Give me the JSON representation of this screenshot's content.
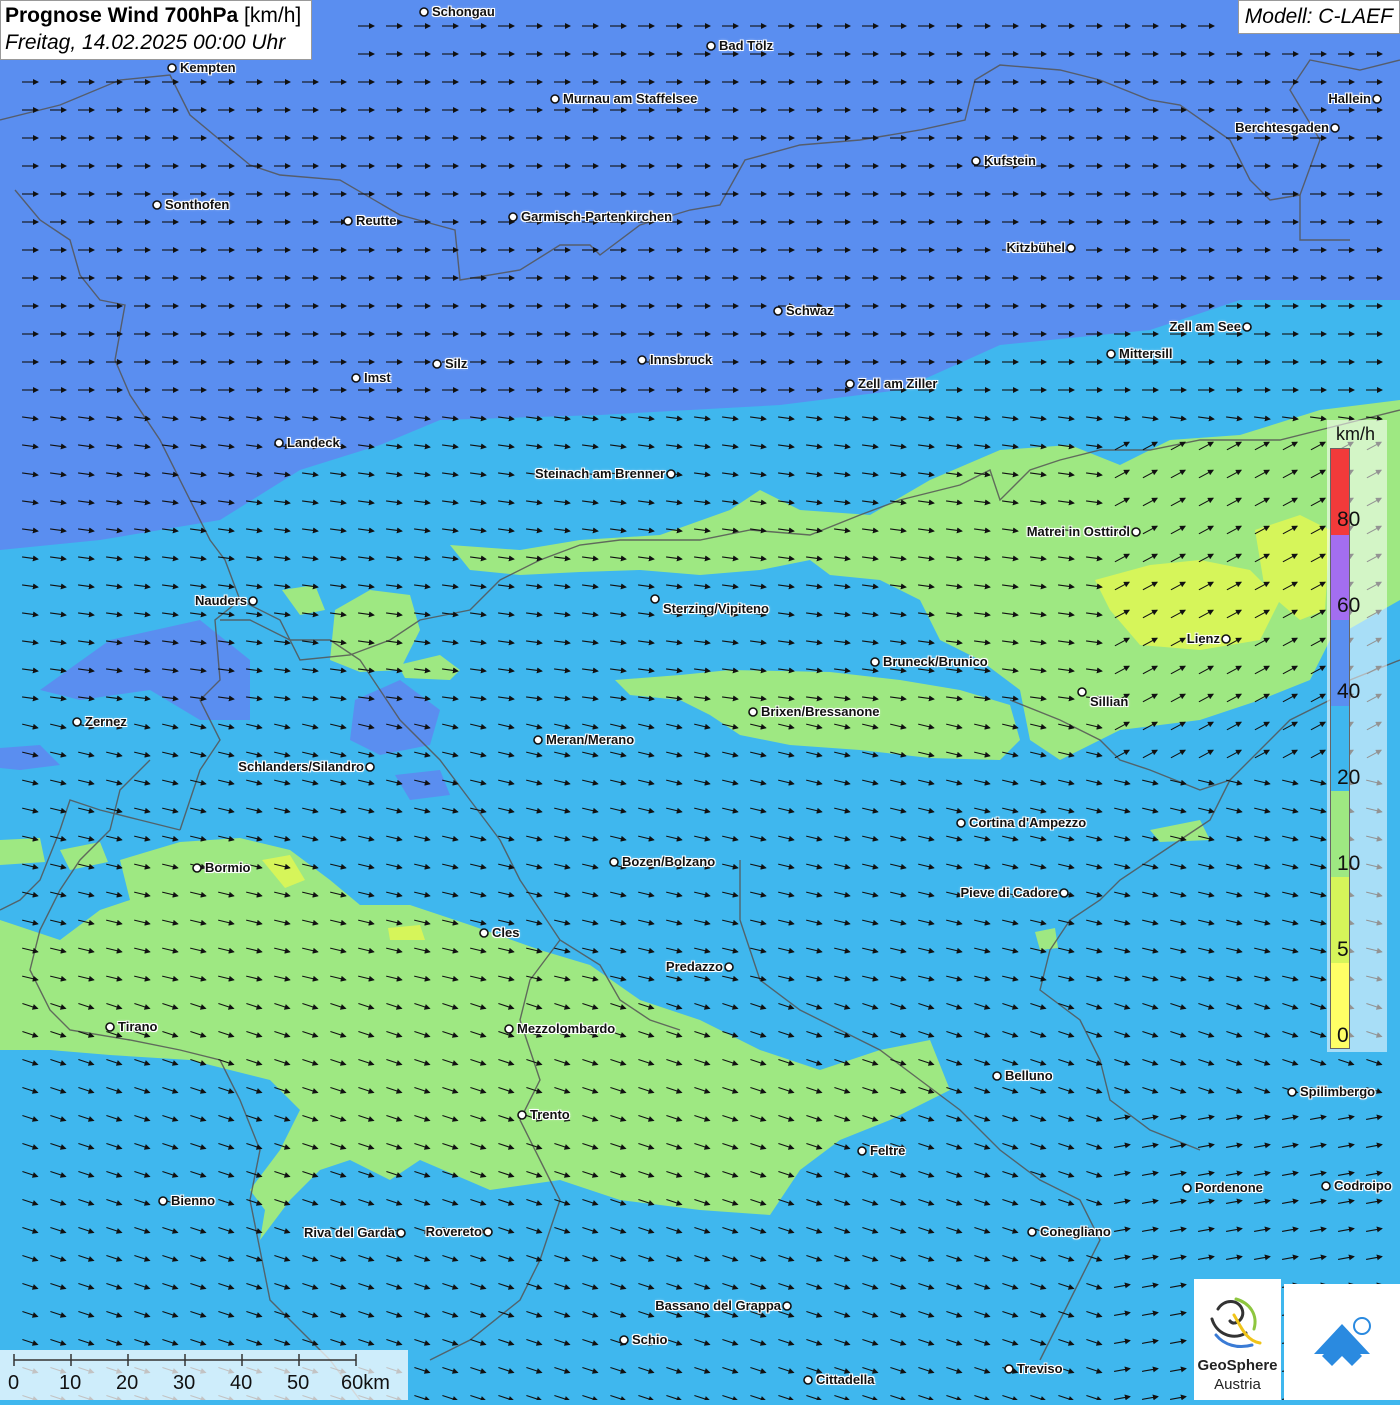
{
  "header": {
    "title_bold": "Prognose Wind 700hPa",
    "title_unit": "[km/h]",
    "datetime": "Freitag, 14.02.2025 00:00 Uhr",
    "model": "Modell: C-LAEF"
  },
  "colors": {
    "speed_0_5": "#ffff66",
    "speed_5_10": "#d6f55a",
    "speed_10_20": "#9ee882",
    "speed_20_40": "#3fb7ee",
    "speed_40_60": "#5a8ef0",
    "speed_60_80": "#a36ef0",
    "speed_80_plus": "#f23a3a",
    "border": "#5a5a5a",
    "arrow": "#111111"
  },
  "legend": {
    "unit": "km/h",
    "labels": [
      "80",
      "60",
      "40",
      "20",
      "10",
      "5",
      "0"
    ]
  },
  "scale_bar": {
    "labels": [
      "0",
      "10",
      "20",
      "30",
      "40",
      "50",
      "60km"
    ]
  },
  "logos": {
    "geosphere_line1": "GeoSphere",
    "geosphere_line2": "Austria",
    "geosphere_icon": "geosphere-logo-icon",
    "cloud_icon": "cloud-arrow-logo-icon"
  },
  "cities": [
    {
      "name": "Schongau"
    },
    {
      "name": "Bad Tölz"
    },
    {
      "name": "Kempten"
    },
    {
      "name": "Murnau am Staffelsee"
    },
    {
      "name": "Hallein"
    },
    {
      "name": "Berchtesgaden"
    },
    {
      "name": "Kufstein"
    },
    {
      "name": "Sonthofen"
    },
    {
      "name": "Reutte"
    },
    {
      "name": "Garmisch-Partenkirchen"
    },
    {
      "name": "Kitzbühel"
    },
    {
      "name": "Schwaz"
    },
    {
      "name": "Zell am See"
    },
    {
      "name": "Mittersill"
    },
    {
      "name": "Innsbruck"
    },
    {
      "name": "Silz"
    },
    {
      "name": "Imst"
    },
    {
      "name": "Zell am Ziller"
    },
    {
      "name": "Landeck"
    },
    {
      "name": "Steinach am Brenner"
    },
    {
      "name": "Matrei in Osttirol"
    },
    {
      "name": "Nauders"
    },
    {
      "name": "Sterzing/Vipiteno"
    },
    {
      "name": "Lienz"
    },
    {
      "name": "Bruneck/Brunico"
    },
    {
      "name": "Sillian"
    },
    {
      "name": "Brixen/Bressanone"
    },
    {
      "name": "Zernez"
    },
    {
      "name": "Meran/Merano"
    },
    {
      "name": "Schlanders/Silandro"
    },
    {
      "name": "Cortina d'Ampezzo"
    },
    {
      "name": "Bozen/Bolzano"
    },
    {
      "name": "Bormio"
    },
    {
      "name": "Pieve di Cadore"
    },
    {
      "name": "Cles"
    },
    {
      "name": "Predazzo"
    },
    {
      "name": "Tirano"
    },
    {
      "name": "Mezzolombardo"
    },
    {
      "name": "Belluno"
    },
    {
      "name": "Spilimbergo"
    },
    {
      "name": "Trento"
    },
    {
      "name": "Feltre"
    },
    {
      "name": "Bienno"
    },
    {
      "name": "Pordenone"
    },
    {
      "name": "Codroipo"
    },
    {
      "name": "Riva del Garda"
    },
    {
      "name": "Rovereto"
    },
    {
      "name": "Conegliano"
    },
    {
      "name": "Bassano del Grappa"
    },
    {
      "name": "Schio"
    },
    {
      "name": "Treviso"
    },
    {
      "name": "Cittadella"
    }
  ]
}
